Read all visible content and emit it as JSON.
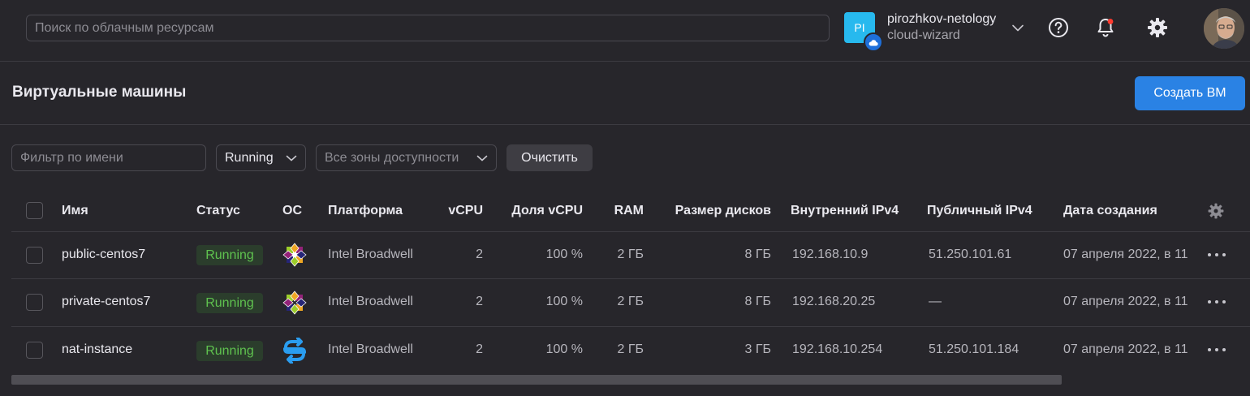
{
  "topbar": {
    "search_placeholder": "Поиск по облачным ресурсам",
    "account_initials": "PI",
    "account_name": "pirozhkov-netology",
    "folder_name": "cloud-wizard",
    "icons": [
      "help-icon",
      "bell-icon",
      "gear-icon"
    ],
    "notification_dot_color": "#ff3b30"
  },
  "header": {
    "title": "Виртуальные машины",
    "create_label": "Создать ВМ"
  },
  "filters": {
    "name_placeholder": "Фильтр по имени",
    "status_value": "Running",
    "zones_placeholder": "Все зоны доступности",
    "clear_label": "Очистить"
  },
  "table": {
    "columns": {
      "name": "Имя",
      "status": "Статус",
      "os": "ОС",
      "platform": "Платформа",
      "vcpu": "vCPU",
      "vcpu_share": "Доля vCPU",
      "ram": "RAM",
      "disk": "Размер дисков",
      "ipv4_internal": "Внутренний IPv4",
      "ipv4_public": "Публичный IPv4",
      "created": "Дата создания"
    },
    "rows": [
      {
        "name": "public-centos7",
        "status": "Running",
        "os_icon": "centos-icon",
        "platform": "Intel Broadwell",
        "vcpu": "2",
        "vcpu_share": "100 %",
        "ram": "2 ГБ",
        "disk": "8 ГБ",
        "ipv4_internal": "192.168.10.9",
        "ipv4_public": "51.250.101.61",
        "created": "07 апреля 2022, в 11"
      },
      {
        "name": "private-centos7",
        "status": "Running",
        "os_icon": "centos-icon",
        "platform": "Intel Broadwell",
        "vcpu": "2",
        "vcpu_share": "100 %",
        "ram": "2 ГБ",
        "disk": "8 ГБ",
        "ipv4_internal": "192.168.20.25",
        "ipv4_public": "—",
        "created": "07 апреля 2022, в 11"
      },
      {
        "name": "nat-instance",
        "status": "Running",
        "os_icon": "nat-instance-icon",
        "platform": "Intel Broadwell",
        "vcpu": "2",
        "vcpu_share": "100 %",
        "ram": "2 ГБ",
        "disk": "3 ГБ",
        "ipv4_internal": "192.168.10.254",
        "ipv4_public": "51.250.101.184",
        "created": "07 апреля 2022, в 11"
      }
    ]
  },
  "colors": {
    "background": "#27262b",
    "accent": "#2a82e4",
    "status_running": "#5fc24f",
    "account_badge": "#27b9ee"
  }
}
